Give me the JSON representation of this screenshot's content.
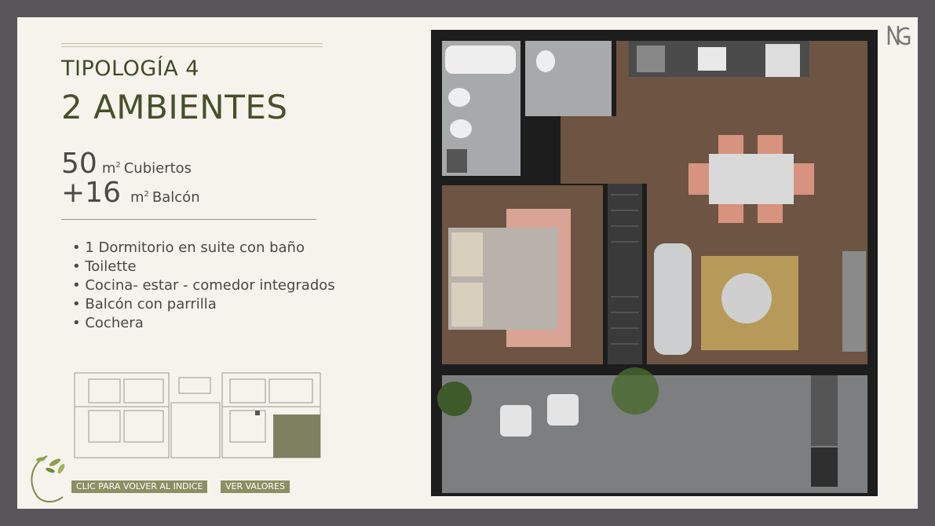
{
  "heading": {
    "typology": "TIPOLOGÍA 4",
    "rooms": "2 AMBIENTES"
  },
  "areas": {
    "covered": {
      "value": "50",
      "unit": "m",
      "sup": "2",
      "label": "Cubiertos"
    },
    "balcony": {
      "value": "+16",
      "unit": "m",
      "sup": "2",
      "label": "Balcón"
    }
  },
  "features": [
    "1 Dormitorio en suite con baño",
    "Toilette",
    "Cocina- estar - comedor integrados",
    "Balcón con parrilla",
    "Cochera"
  ],
  "buttons": {
    "back": "CLIC PARA VOLVER AL INDICE",
    "prices": "VER VALORES"
  },
  "colors": {
    "accent": "#46502b",
    "button": "#8b9063",
    "frame": "#58565a",
    "floor": "#6e5442"
  }
}
